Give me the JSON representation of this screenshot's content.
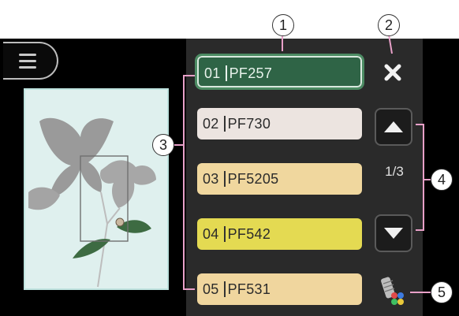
{
  "callouts": [
    "1",
    "2",
    "3",
    "4",
    "5"
  ],
  "threads": [
    {
      "num": "01",
      "code": "PF257",
      "color": "#2f6446"
    },
    {
      "num": "02",
      "code": "PF730",
      "color": "#ece4e0"
    },
    {
      "num": "03",
      "code": "PF5205",
      "color": "#f0d79e"
    },
    {
      "num": "04",
      "code": "PF542",
      "color": "#e4da52"
    },
    {
      "num": "05",
      "code": "PF531",
      "color": "#f0d69e"
    }
  ],
  "pager": {
    "text": "1/3"
  },
  "icons": {
    "menu": "hamburger-icon",
    "close": "close-icon",
    "up": "arrow-up-icon",
    "down": "arrow-down-icon",
    "thread_color": "thread-palette-icon"
  },
  "colors": {
    "selected_outline": "#4c8b63",
    "panel_bg": "#2a2a2a",
    "callout_line": "#e8a0c8"
  }
}
